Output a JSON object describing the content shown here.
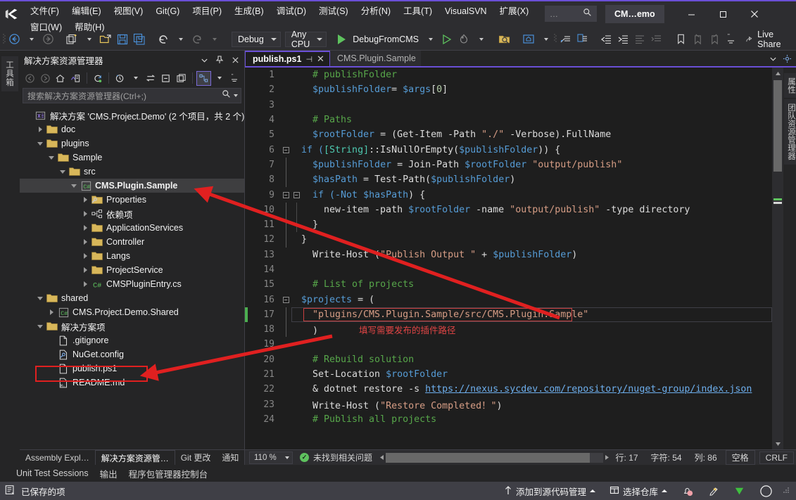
{
  "window": {
    "logo": "visual-studio-logo",
    "feedback_button": "CM…emo",
    "quick_launch_placeholder": "…",
    "minimize": "—",
    "maximize": "☐",
    "close": "✕"
  },
  "menubar": {
    "items": [
      "文件(F)",
      "编辑(E)",
      "视图(V)",
      "Git(G)",
      "项目(P)",
      "生成(B)",
      "调试(D)",
      "测试(S)",
      "分析(N)",
      "工具(T)",
      "VisualSVN",
      "扩展(X)",
      "窗口(W)",
      "帮助(H)"
    ]
  },
  "toolbar": {
    "config_combo": "Debug",
    "platform_combo": "Any CPU",
    "run_target": "DebugFromCMS",
    "live_share": "Live Share"
  },
  "left_rail": {
    "tabs": [
      "工具箱"
    ]
  },
  "right_rail": {
    "tabs": [
      "属性",
      "团队资源管理器"
    ]
  },
  "solution_explorer": {
    "title": "解决方案资源管理器",
    "search_placeholder": "搜索解决方案资源管理器(Ctrl+;)",
    "header_buttons": [
      "chevron-down-icon",
      "pin-icon",
      "close-icon"
    ],
    "toolbar_icons": [
      "back-icon",
      "forward-icon",
      "home-icon",
      "switch-views-icon",
      "refresh-icon",
      "pending-changes-icon",
      "collapse-all-icon",
      "show-all-files-icon",
      "properties-icon",
      "solution-scope-icon"
    ],
    "tree": [
      {
        "depth": 0,
        "arrow": "none",
        "icon": "solution-icon",
        "label": "解决方案 'CMS.Project.Demo' (2 个项目，共 2 个)",
        "selected": false,
        "bold": false
      },
      {
        "depth": 1,
        "arrow": "right",
        "icon": "folder-icon",
        "label": "doc",
        "selected": false,
        "bold": false
      },
      {
        "depth": 1,
        "arrow": "down",
        "icon": "folder-icon",
        "label": "plugins",
        "selected": false,
        "bold": false
      },
      {
        "depth": 2,
        "arrow": "down",
        "icon": "folder-icon",
        "label": "Sample",
        "selected": false,
        "bold": false
      },
      {
        "depth": 3,
        "arrow": "down",
        "icon": "folder-icon",
        "label": "src",
        "selected": false,
        "bold": false
      },
      {
        "depth": 4,
        "arrow": "down",
        "icon": "csharp-project-icon",
        "label": "CMS.Plugin.Sample",
        "selected": true,
        "bold": true
      },
      {
        "depth": 5,
        "arrow": "right",
        "icon": "properties-folder-icon",
        "label": "Properties",
        "selected": false,
        "bold": false
      },
      {
        "depth": 5,
        "arrow": "right",
        "icon": "dependencies-icon",
        "label": "依赖项",
        "selected": false,
        "bold": false
      },
      {
        "depth": 5,
        "arrow": "right",
        "icon": "folder-icon",
        "label": "ApplicationServices",
        "selected": false,
        "bold": false
      },
      {
        "depth": 5,
        "arrow": "right",
        "icon": "folder-icon",
        "label": "Controller",
        "selected": false,
        "bold": false
      },
      {
        "depth": 5,
        "arrow": "right",
        "icon": "folder-icon",
        "label": "Langs",
        "selected": false,
        "bold": false
      },
      {
        "depth": 5,
        "arrow": "right",
        "icon": "folder-icon",
        "label": "ProjectService",
        "selected": false,
        "bold": false
      },
      {
        "depth": 5,
        "arrow": "right",
        "icon": "csharp-file-icon",
        "label": "CMSPluginEntry.cs",
        "selected": false,
        "bold": false
      },
      {
        "depth": 1,
        "arrow": "down",
        "icon": "folder-icon",
        "label": "shared",
        "selected": false,
        "bold": false
      },
      {
        "depth": 2,
        "arrow": "right",
        "icon": "csharp-project-icon",
        "label": "CMS.Project.Demo.Shared",
        "selected": false,
        "bold": false
      },
      {
        "depth": 1,
        "arrow": "down",
        "icon": "folder-icon",
        "label": "解决方案项",
        "selected": false,
        "bold": false
      },
      {
        "depth": 2,
        "arrow": "none",
        "icon": "file-icon",
        "label": ".gitignore",
        "selected": false,
        "bold": false
      },
      {
        "depth": 2,
        "arrow": "none",
        "icon": "config-file-icon",
        "label": "NuGet.config",
        "selected": false,
        "bold": false
      },
      {
        "depth": 2,
        "arrow": "none",
        "icon": "file-icon",
        "label": "publish.ps1",
        "selected": false,
        "bold": false,
        "highlight": true
      },
      {
        "depth": 2,
        "arrow": "none",
        "icon": "markdown-file-icon",
        "label": "README.md",
        "selected": false,
        "bold": false
      }
    ],
    "dock_tabs": [
      {
        "label": "Assembly Expl…",
        "active": false
      },
      {
        "label": "解决方案资源管…",
        "active": true
      },
      {
        "label": "Git 更改",
        "active": false
      },
      {
        "label": "通知",
        "active": false
      }
    ]
  },
  "editor": {
    "tabs": [
      {
        "label": "publish.ps1",
        "active": true,
        "pin": "⊣",
        "close": "✕"
      },
      {
        "label": "CMS.Plugin.Sample",
        "active": false
      }
    ],
    "lines": [
      {
        "n": 1,
        "fold": "",
        "indent": 1,
        "tokens": [
          {
            "t": "# publishFolder",
            "c": "cm"
          }
        ]
      },
      {
        "n": 2,
        "fold": "",
        "indent": 1,
        "tokens": [
          {
            "t": "$publishFolder",
            "c": "var"
          },
          {
            "t": "= ",
            "c": "plain"
          },
          {
            "t": "$args",
            "c": "var"
          },
          {
            "t": "[",
            "c": "plain"
          },
          {
            "t": "0",
            "c": "num"
          },
          {
            "t": "]",
            "c": "plain"
          }
        ]
      },
      {
        "n": 3,
        "fold": "",
        "indent": 1,
        "tokens": []
      },
      {
        "n": 4,
        "fold": "",
        "indent": 1,
        "tokens": [
          {
            "t": "# Paths",
            "c": "cm"
          }
        ]
      },
      {
        "n": 5,
        "fold": "",
        "indent": 1,
        "tokens": [
          {
            "t": "$rootFolder",
            "c": "var"
          },
          {
            "t": " = (Get-Item -Path ",
            "c": "plain"
          },
          {
            "t": "\"./\"",
            "c": "str"
          },
          {
            "t": " -Verbose).FullName",
            "c": "plain"
          }
        ]
      },
      {
        "n": 6,
        "fold": "open",
        "indent": 0,
        "tokens": [
          {
            "t": "if (",
            "c": "kw"
          },
          {
            "t": "[String]",
            "c": "typ"
          },
          {
            "t": "::IsNullOrEmpty(",
            "c": "plain"
          },
          {
            "t": "$publishFolder",
            "c": "var"
          },
          {
            "t": ")) {",
            "c": "plain"
          }
        ]
      },
      {
        "n": 7,
        "fold": "bar",
        "indent": 1,
        "tokens": [
          {
            "t": "$publishFolder",
            "c": "var"
          },
          {
            "t": " = Join-Path ",
            "c": "plain"
          },
          {
            "t": "$rootFolder",
            "c": "var"
          },
          {
            "t": " ",
            "c": "plain"
          },
          {
            "t": "\"output/publish\"",
            "c": "str"
          }
        ]
      },
      {
        "n": 8,
        "fold": "bar",
        "indent": 1,
        "tokens": [
          {
            "t": "$hasPath",
            "c": "var"
          },
          {
            "t": " = Test-Path(",
            "c": "plain"
          },
          {
            "t": "$publishFolder",
            "c": "var"
          },
          {
            "t": ")",
            "c": "plain"
          }
        ]
      },
      {
        "n": 9,
        "fold": "open2",
        "indent": 1,
        "tokens": [
          {
            "t": "if (-Not ",
            "c": "kw"
          },
          {
            "t": "$hasPath",
            "c": "var"
          },
          {
            "t": ") {",
            "c": "plain"
          }
        ]
      },
      {
        "n": 10,
        "fold": "bar2",
        "indent": 2,
        "tokens": [
          {
            "t": "new-item -path ",
            "c": "plain"
          },
          {
            "t": "$rootFolder",
            "c": "var"
          },
          {
            "t": " -name ",
            "c": "plain"
          },
          {
            "t": "\"output/publish\"",
            "c": "str"
          },
          {
            "t": " -type directory",
            "c": "plain"
          }
        ]
      },
      {
        "n": 11,
        "fold": "end2",
        "indent": 1,
        "tokens": [
          {
            "t": "}",
            "c": "plain"
          }
        ]
      },
      {
        "n": 12,
        "fold": "end",
        "indent": 0,
        "tokens": [
          {
            "t": "}",
            "c": "plain"
          }
        ]
      },
      {
        "n": 13,
        "fold": "",
        "indent": 1,
        "tokens": [
          {
            "t": "Write-Host (",
            "c": "plain"
          },
          {
            "t": "\"Publish Output \"",
            "c": "str"
          },
          {
            "t": " + ",
            "c": "plain"
          },
          {
            "t": "$publishFolder",
            "c": "var"
          },
          {
            "t": ")",
            "c": "plain"
          }
        ]
      },
      {
        "n": 14,
        "fold": "",
        "indent": 1,
        "tokens": []
      },
      {
        "n": 15,
        "fold": "",
        "indent": 1,
        "tokens": [
          {
            "t": "# List of projects",
            "c": "cm"
          }
        ]
      },
      {
        "n": 16,
        "fold": "open",
        "indent": 0,
        "tokens": [
          {
            "t": "$projects",
            "c": "var"
          },
          {
            "t": " = (",
            "c": "plain"
          }
        ]
      },
      {
        "n": 17,
        "fold": "bar",
        "indent": 1,
        "tokens": [
          {
            "t": "\"plugins/CMS.Plugin.Sample/src/CMS.Plugin.Sample\"",
            "c": "str"
          }
        ],
        "current": true,
        "changed": true
      },
      {
        "n": 18,
        "fold": "end",
        "indent": 1,
        "tokens": [
          {
            "t": ")",
            "c": "plain"
          }
        ],
        "annotation": "填写需要发布的插件路径"
      },
      {
        "n": 19,
        "fold": "",
        "indent": 1,
        "tokens": []
      },
      {
        "n": 20,
        "fold": "",
        "indent": 1,
        "tokens": [
          {
            "t": "# Rebuild solution",
            "c": "cm"
          }
        ]
      },
      {
        "n": 21,
        "fold": "",
        "indent": 1,
        "tokens": [
          {
            "t": "Set-Location ",
            "c": "plain"
          },
          {
            "t": "$rootFolder",
            "c": "var"
          }
        ]
      },
      {
        "n": 22,
        "fold": "",
        "indent": 1,
        "tokens": [
          {
            "t": "& dotnet restore -s ",
            "c": "plain"
          },
          {
            "t": "https://nexus.sycdev.com/repository/nuget-group/index.json",
            "c": "lnk"
          }
        ]
      },
      {
        "n": 23,
        "fold": "",
        "indent": 1,
        "tokens": [
          {
            "t": "Write-Host (",
            "c": "plain"
          },
          {
            "t": "\"Restore Completed！\"",
            "c": "str"
          },
          {
            "t": ")",
            "c": "plain"
          }
        ]
      },
      {
        "n": 24,
        "fold": "",
        "indent": 1,
        "tokens": [
          {
            "t": "# Publish all projects",
            "c": "cm"
          }
        ]
      }
    ],
    "annotation_text": "填写需要发布的插件路径"
  },
  "editor_status": {
    "zoom": "110 %",
    "issues": "未找到相关问题",
    "line_label": "行:",
    "line_value": "17",
    "char_label": "字符:",
    "char_value": "54",
    "col_label": "列:",
    "col_value": "86",
    "spaces": "空格",
    "eol": "CRLF"
  },
  "bottom_tabs": [
    "Unit Test Sessions",
    "输出",
    "程序包管理器控制台"
  ],
  "statusbar": {
    "message": "已保存的项",
    "source_control": "添加到源代码管理",
    "repository": "选择仓库",
    "icons": [
      "notification-bell-icon",
      "feedback-icon",
      "ready-check-icon",
      "circle-icon"
    ]
  },
  "colors": {
    "accent_purple": "#6a4fd6",
    "annotation_red": "#e02020",
    "comment_green": "#57a64a",
    "string_orange": "#d69d85",
    "variable_blue": "#569cd6",
    "type_teal": "#4ec9b0",
    "chrome_dark": "#2d2d30",
    "editor_bg": "#1e1e1e"
  }
}
